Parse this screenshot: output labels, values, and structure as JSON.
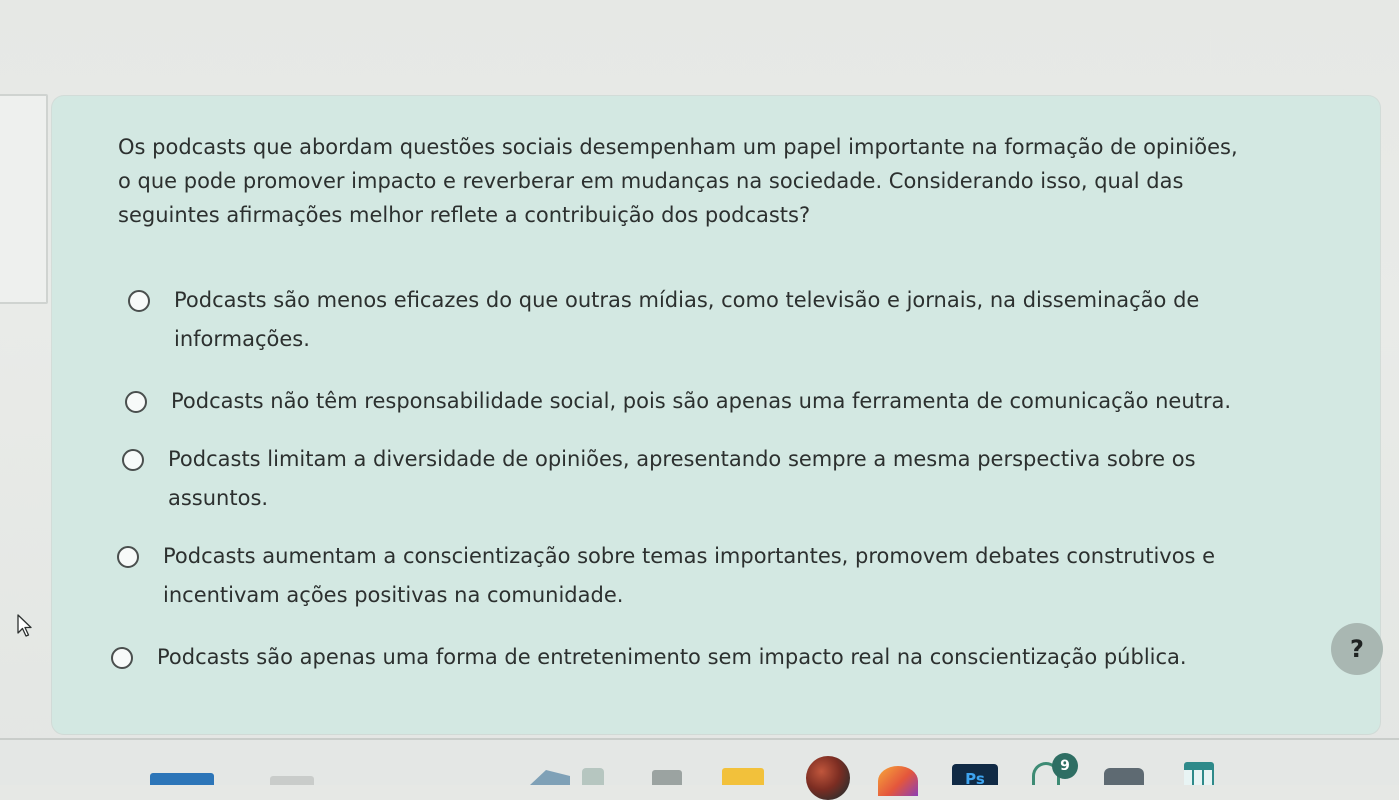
{
  "question": {
    "line1": "Os podcasts que abordam questões sociais desempenham um papel importante na formação de opiniões,",
    "line2": "o que pode promover impacto e reverberar em mudanças na sociedade. Considerando isso, qual das",
    "line3": "seguintes afirmações melhor reflete a contribuição dos podcasts?"
  },
  "options": [
    {
      "line1": "Podcasts são menos eficazes do que outras mídias, como televisão e jornais, na disseminação de",
      "line2": "informações.",
      "selected": false
    },
    {
      "line1": "Podcasts não têm responsabilidade social, pois são apenas uma ferramenta de comunicação neutra.",
      "line2": "",
      "selected": false
    },
    {
      "line1": "Podcasts limitam a diversidade de opiniões, apresentando sempre a mesma perspectiva sobre os",
      "line2": "assuntos.",
      "selected": false
    },
    {
      "line1": "Podcasts aumentam a conscientização sobre temas importantes, promovem debates construtivos e",
      "line2": "incentivam ações positivas na comunidade.",
      "selected": false
    },
    {
      "line1": "Podcasts são apenas uma forma de entretenimento sem impacto real na conscientização pública.",
      "line2": "",
      "selected": false
    }
  ],
  "help_button": {
    "label": "?"
  },
  "taskbar": {
    "photoshop_label": "Ps",
    "notification_count": "9"
  },
  "colors": {
    "card_background": "#d3e8e2",
    "page_background": "#e6e8e5",
    "text": "#2c302f",
    "help_button": "#a9b7b2",
    "taskbar_accent": "#2c75b8"
  }
}
